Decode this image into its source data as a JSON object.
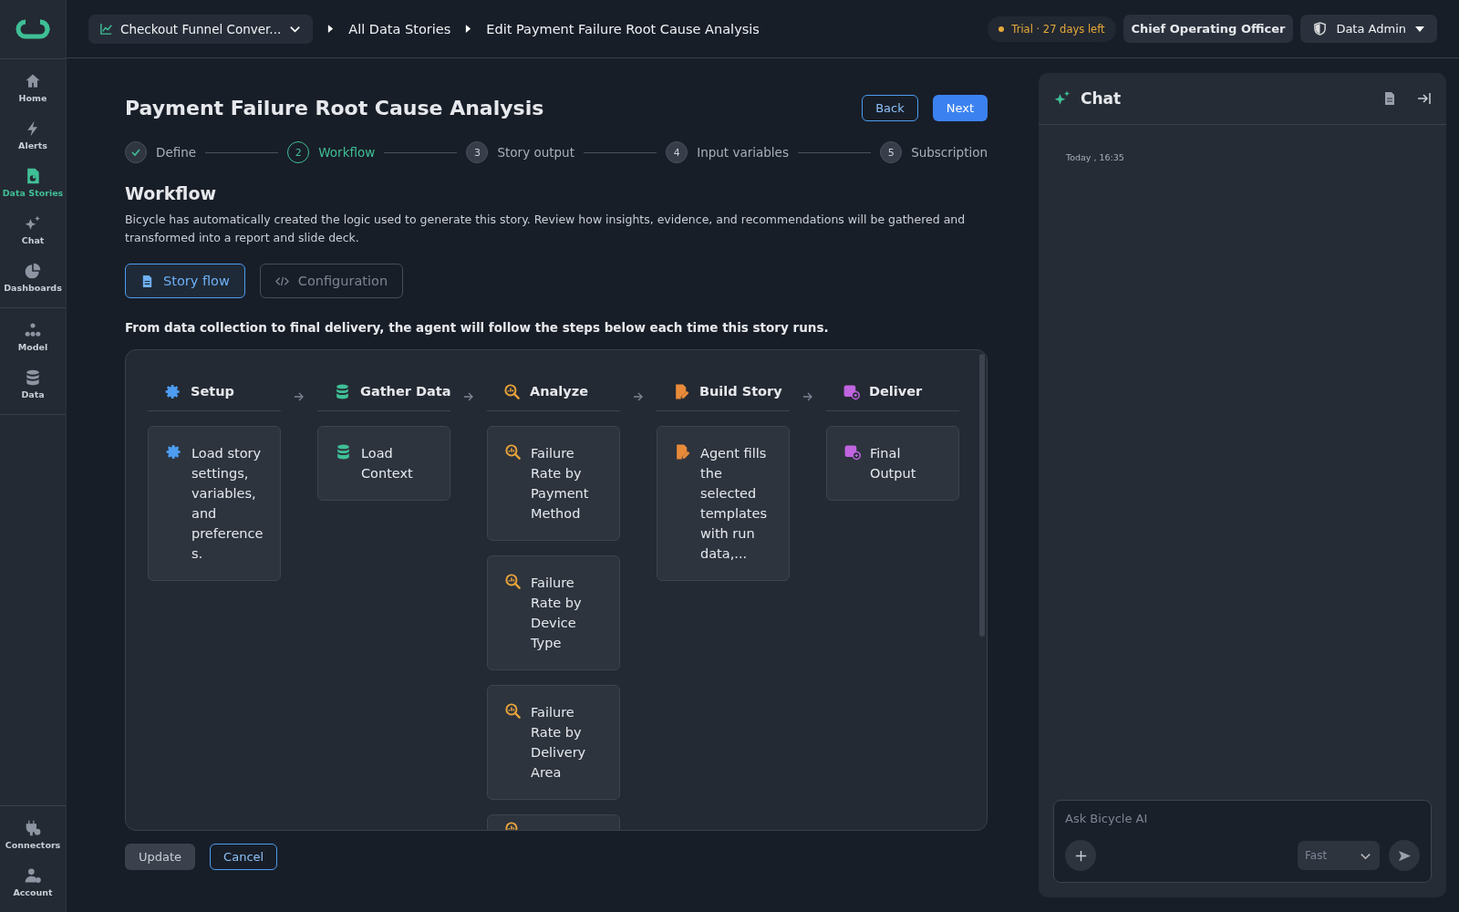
{
  "topbar": {
    "dataset": "Checkout Funnel Conver...",
    "breadcrumbs": [
      "All Data Stories",
      "Edit Payment Failure Root Cause Analysis"
    ],
    "trial": "Trial · 27 days left",
    "role": "Chief Operating Officer",
    "user": "Data Admin"
  },
  "sidebar": {
    "groups": [
      [
        {
          "label": "Home",
          "selected": false
        },
        {
          "label": "Alerts",
          "selected": false
        },
        {
          "label": "Data Stories",
          "selected": true
        },
        {
          "label": "Chat",
          "selected": false
        },
        {
          "label": "Dashboards",
          "selected": false
        }
      ],
      [
        {
          "label": "Model",
          "selected": false
        },
        {
          "label": "Data",
          "selected": false
        }
      ]
    ],
    "bottom": [
      {
        "label": "Connectors",
        "selected": false
      },
      {
        "label": "Account",
        "selected": false
      }
    ]
  },
  "page": {
    "title": "Payment Failure Root Cause Analysis",
    "buttons": [
      "Back",
      "Next"
    ],
    "steps": [
      {
        "label": "Define",
        "completed": true,
        "selected": false
      },
      {
        "number": "2",
        "label": "Workflow",
        "completed": false,
        "selected": true
      },
      {
        "number": "3",
        "label": "Story output",
        "completed": false,
        "selected": false
      },
      {
        "number": "4",
        "label": "Input variables",
        "completed": false,
        "selected": false
      },
      {
        "number": "5",
        "label": "Subscription",
        "completed": false,
        "selected": false
      }
    ],
    "section_title": "Workflow",
    "description": "Bicycle has automatically created the logic used to generate this story. Review how insights, evidence, and recommendations will be gathered and transformed into a report and slide deck.",
    "tabs": [
      {
        "label": "Story flow",
        "selected": true
      },
      {
        "label": "Configuration",
        "selected": false
      }
    ],
    "intro": "From data collection to final delivery, the agent will follow the steps below each time this story runs.",
    "columns": [
      {
        "kind": "setup",
        "title": "Setup",
        "cards": [
          "Load story settings, variables, and preferences."
        ],
        "more_below": false
      },
      {
        "kind": "gather",
        "title": "Gather Data",
        "cards": [
          "Load Context"
        ],
        "more_below": false
      },
      {
        "kind": "analyze",
        "title": "Analyze",
        "cards": [
          "Failure Rate by Payment Method",
          "Failure Rate by Device Type",
          "Failure Rate by Delivery Area"
        ],
        "more_below": true
      },
      {
        "kind": "build",
        "title": "Build Story",
        "cards": [
          "Agent fills the selected templates with run data,..."
        ],
        "more_below": false
      },
      {
        "kind": "deliver",
        "title": "Deliver",
        "cards": [
          "Final Output"
        ],
        "more_below": false
      }
    ],
    "footer_buttons": [
      "Update",
      "Cancel"
    ]
  },
  "chat": {
    "title": "Chat",
    "timestamp": "Today , 16:35",
    "placeholder": "Ask Bicycle AI",
    "mode": "Fast"
  }
}
